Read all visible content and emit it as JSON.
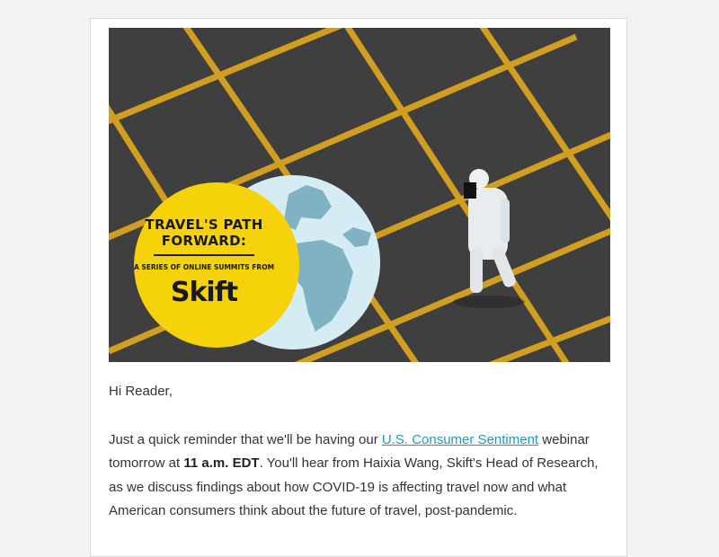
{
  "hero": {
    "title": "TRAVEL'S PATH FORWARD:",
    "subtitle": "A SERIES OF ONLINE SUMMITS FROM",
    "logo_text": "Skift",
    "colors": {
      "badge": "#f5d20a",
      "globe": "#cfe6ef",
      "land": "#7fb2c2",
      "asphalt": "#3b3b3b",
      "lines": "#d9a41e"
    }
  },
  "email": {
    "greeting": "Hi Reader,",
    "p1_before_link": "Just a quick reminder that we'll be having our ",
    "p1_link": "U.S. Consumer Sentiment",
    "p1_after_link": " webinar tomorrow at ",
    "p1_bold": "11 a.m. EDT",
    "p1_rest": ". You'll hear from Haixia Wang, Skift's Head of Research, as we discuss findings about how COVID-19 is affecting travel now and what American consumers think about the future of travel, post-pandemic."
  }
}
